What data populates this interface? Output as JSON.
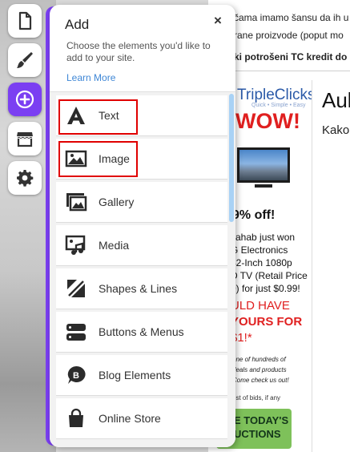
{
  "background": {
    "top_lines": [
      "čama imamo šansu da ih u",
      "rane proizvode (poput mo",
      "ki potrošeni TC kredit do"
    ],
    "ad": {
      "logo": "TripleClicks",
      "logo_sub": "Quick • Simple • Easy",
      "headline": "WOW!",
      "offer": "9% off!",
      "body_lines": [
        "vahab just won",
        "G Electronics",
        "42-Inch 1080p",
        "D TV (Retail Price",
        "0) for just $0.99!"
      ],
      "red_lines": [
        "ULD HAVE",
        "YOURS FOR",
        "$1!*"
      ],
      "small_lines": [
        "one of hundreds of",
        "deals and products",
        "Come check us out!"
      ],
      "note": "ost of bids, if any",
      "button_lines": [
        "E TODAY'S",
        "UCTIONS"
      ]
    },
    "right_title": "Aul",
    "right_sub": "Kako"
  },
  "toolbar": {
    "buttons": [
      {
        "name": "pages-icon",
        "active": false
      },
      {
        "name": "design-brush-icon",
        "active": false
      },
      {
        "name": "add-plus-icon",
        "active": true
      },
      {
        "name": "store-icon",
        "active": false
      },
      {
        "name": "settings-gear-icon",
        "active": false
      }
    ],
    "accent_color": "#7b3ff2"
  },
  "panel": {
    "title": "Add",
    "close": "×",
    "description": "Choose the elements you'd like to add to your site.",
    "learn_more": "Learn More",
    "items": [
      {
        "label": "Text",
        "icon": "text-a-icon",
        "highlighted": true
      },
      {
        "label": "Image",
        "icon": "image-icon",
        "highlighted": true
      },
      {
        "label": "Gallery",
        "icon": "gallery-icon",
        "highlighted": false
      },
      {
        "label": "Media",
        "icon": "media-icon",
        "highlighted": false
      },
      {
        "label": "Shapes & Lines",
        "icon": "shapes-lines-icon",
        "highlighted": false
      },
      {
        "label": "Buttons & Menus",
        "icon": "buttons-menus-icon",
        "highlighted": false
      },
      {
        "label": "Blog Elements",
        "icon": "blog-elements-icon",
        "highlighted": false
      },
      {
        "label": "Online Store",
        "icon": "online-store-icon",
        "highlighted": false
      }
    ]
  }
}
